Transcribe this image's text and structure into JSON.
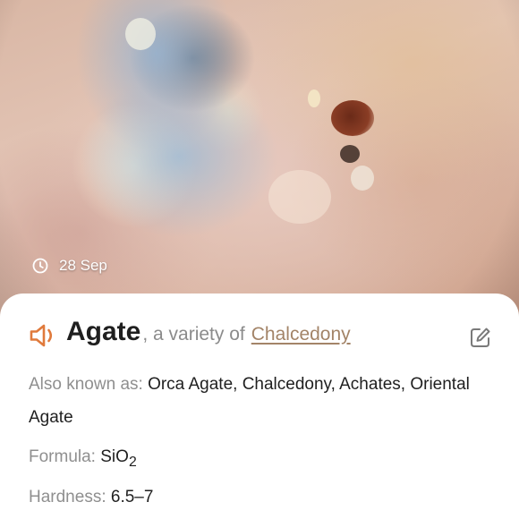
{
  "photo": {
    "date": "28 Sep"
  },
  "mineral": {
    "name": "Agate",
    "variety_text": ", a variety of",
    "parent": "Chalcedony",
    "also_known_as_label": "Also known as:",
    "also_known_as": "Orca Agate, Chalcedony, Achates, Oriental Agate",
    "formula_label": "Formula:",
    "formula_base": "SiO",
    "formula_subscript": "2",
    "hardness_label": "Hardness:",
    "hardness": "6.5–7"
  },
  "icons": {
    "speaker": "speaker-icon",
    "edit": "edit-icon",
    "clock": "clock-icon"
  },
  "colors": {
    "accent": "#e07a3c",
    "link": "#a38468",
    "label": "#8f8f8f",
    "text": "#1f1f1f"
  }
}
